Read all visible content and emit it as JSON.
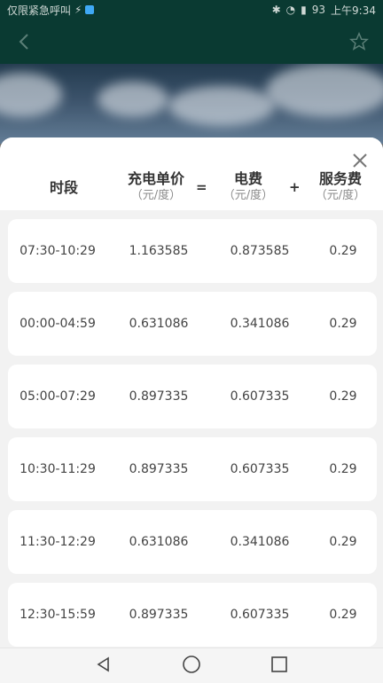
{
  "statusbar": {
    "carrier": "仅限紧急呼叫",
    "battery": "93",
    "time": "上午9:34"
  },
  "header": {
    "columns": [
      {
        "label": "时段",
        "unit": ""
      },
      {
        "label": "充电单价",
        "unit": "（元/度）"
      },
      {
        "label": "电费",
        "unit": "（元/度）"
      },
      {
        "label": "服务费",
        "unit": "（元/度）"
      }
    ],
    "ops": [
      "=",
      "+"
    ]
  },
  "rows": [
    {
      "period": "07:30-10:29",
      "unit_price": "1.163585",
      "electric_fee": "0.873585",
      "service_fee": "0.29"
    },
    {
      "period": "00:00-04:59",
      "unit_price": "0.631086",
      "electric_fee": "0.341086",
      "service_fee": "0.29"
    },
    {
      "period": "05:00-07:29",
      "unit_price": "0.897335",
      "electric_fee": "0.607335",
      "service_fee": "0.29"
    },
    {
      "period": "10:30-11:29",
      "unit_price": "0.897335",
      "electric_fee": "0.607335",
      "service_fee": "0.29"
    },
    {
      "period": "11:30-12:29",
      "unit_price": "0.631086",
      "electric_fee": "0.341086",
      "service_fee": "0.29"
    },
    {
      "period": "12:30-15:59",
      "unit_price": "0.897335",
      "electric_fee": "0.607335",
      "service_fee": "0.29"
    }
  ],
  "icons": {
    "back": "back-arrow-icon",
    "favorite": "star-icon",
    "close": "close-icon"
  },
  "colors": {
    "appbar": "#0a3a32",
    "sheet_bg": "#f2f2f2",
    "card": "#ffffff"
  }
}
